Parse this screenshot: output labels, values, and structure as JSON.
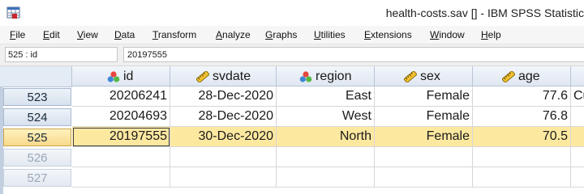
{
  "window": {
    "title": "health-costs.sav [] - IBM SPSS Statistic",
    "app_icon": "spss-data-editor-icon"
  },
  "menu": {
    "items": [
      {
        "underline": "F",
        "rest": "ile"
      },
      {
        "underline": "E",
        "rest": "dit"
      },
      {
        "underline": "V",
        "rest": "iew"
      },
      {
        "underline": "D",
        "rest": "ata"
      },
      {
        "underline": "T",
        "rest": "ransform"
      },
      {
        "underline": "A",
        "rest": "nalyze"
      },
      {
        "underline": "G",
        "rest": "raphs"
      },
      {
        "underline": "U",
        "rest": "tilities"
      },
      {
        "underline": "E",
        "rest": "xtensions"
      },
      {
        "underline": "W",
        "rest": "indow"
      },
      {
        "underline": "H",
        "rest": "elp"
      }
    ]
  },
  "cell_reference": {
    "name": "525 : id",
    "value": "20197555"
  },
  "grid": {
    "columns": [
      {
        "label": "id",
        "icon": "nominal-icon"
      },
      {
        "label": "svdate",
        "icon": "scale-icon"
      },
      {
        "label": "region",
        "icon": "nominal-icon"
      },
      {
        "label": "sex",
        "icon": "scale-icon"
      },
      {
        "label": "age",
        "icon": "scale-icon"
      }
    ],
    "rows": [
      {
        "number": "523",
        "cells": [
          "20206241",
          "28-Dec-2020",
          "East",
          "Female",
          "77.6",
          "Cu"
        ]
      },
      {
        "number": "524",
        "cells": [
          "20204693",
          "28-Dec-2020",
          "West",
          "Female",
          "76.8",
          ""
        ]
      },
      {
        "number": "525",
        "cells": [
          "20197555",
          "30-Dec-2020",
          "North",
          "Female",
          "70.5",
          ""
        ]
      },
      {
        "number": "526",
        "cells": [
          "",
          "",
          "",
          "",
          "",
          ""
        ]
      },
      {
        "number": "527",
        "cells": [
          "",
          "",
          "",
          "",
          "",
          ""
        ]
      }
    ],
    "selected_row": "525",
    "colors": {
      "selection": "#fde8a0",
      "header": "#dfe7f2"
    }
  }
}
